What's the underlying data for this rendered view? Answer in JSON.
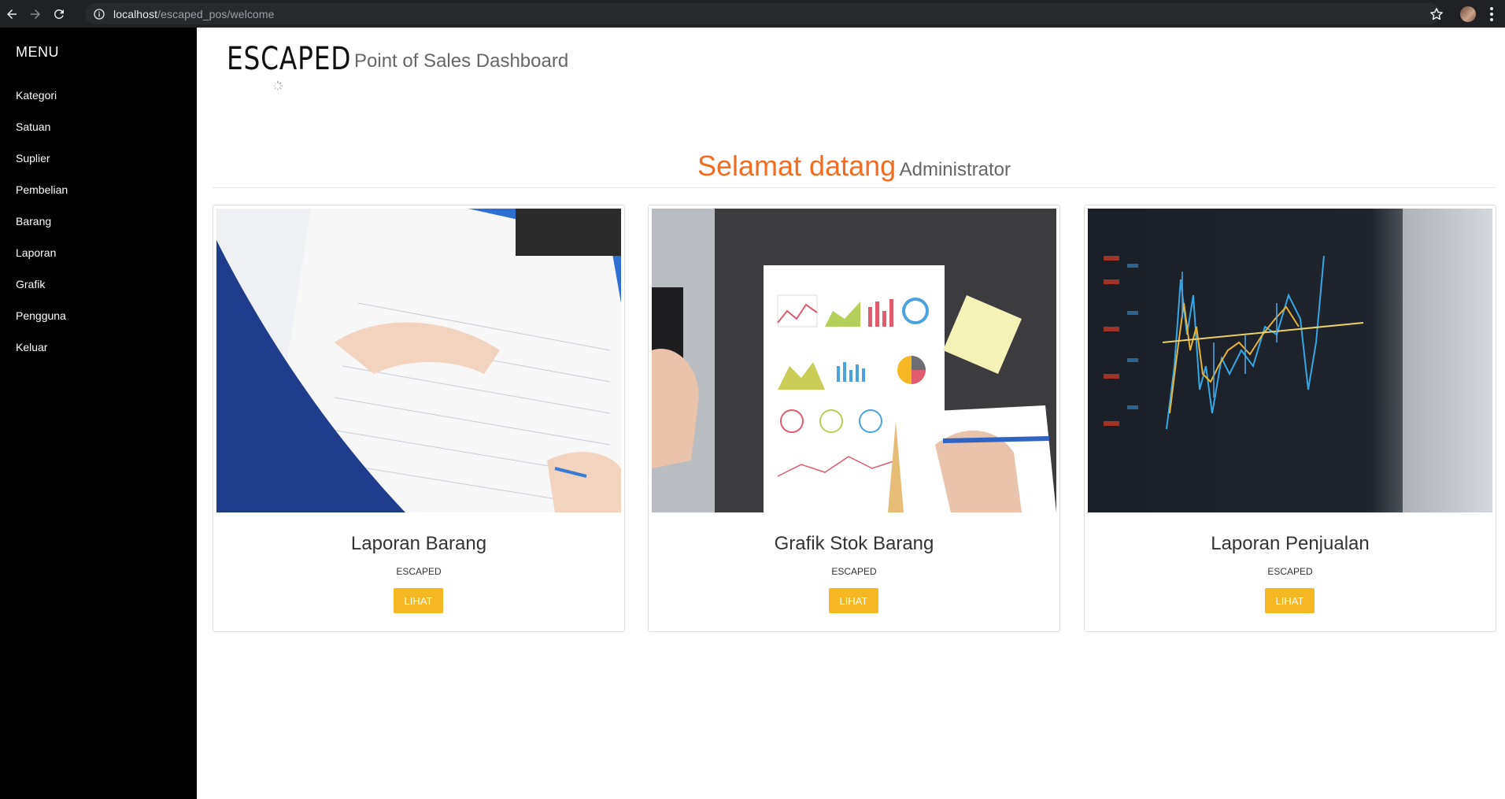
{
  "browser": {
    "url_host": "localhost",
    "url_path": "/escaped_pos/welcome"
  },
  "sidebar": {
    "title": "MENU",
    "items": [
      {
        "label": "Kategori"
      },
      {
        "label": "Satuan"
      },
      {
        "label": "Suplier"
      },
      {
        "label": "Pembelian"
      },
      {
        "label": "Barang"
      },
      {
        "label": "Laporan"
      },
      {
        "label": "Grafik"
      },
      {
        "label": "Pengguna"
      },
      {
        "label": "Keluar"
      }
    ]
  },
  "header": {
    "logo_text": "ESCAPED",
    "title": "Point of Sales Dashboard"
  },
  "welcome": {
    "greeting": "Selamat datang",
    "role": "Administrator"
  },
  "cards": [
    {
      "title": "Laporan Barang",
      "subtitle": "ESCAPED",
      "button": "LIHAT",
      "image": "writing-report-photo"
    },
    {
      "title": "Grafik Stok Barang",
      "subtitle": "ESCAPED",
      "button": "LIHAT",
      "image": "charts-document-photo"
    },
    {
      "title": "Laporan Penjualan",
      "subtitle": "ESCAPED",
      "button": "LIHAT",
      "image": "stock-market-screen-photo"
    }
  ],
  "colors": {
    "accent_orange": "#f26c21",
    "button_yellow": "#f5b823",
    "sidebar_bg": "#000000"
  }
}
